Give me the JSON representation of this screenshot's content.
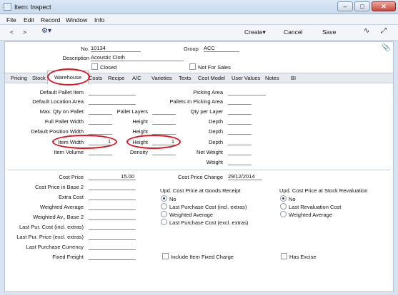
{
  "window": {
    "title": "Item: Inspect",
    "minimize": "–",
    "maximize": "□",
    "close": "✕"
  },
  "menu": [
    "File",
    "Edit",
    "Record",
    "Window",
    "Info"
  ],
  "toolbar": {
    "prev": "<",
    "next": ">",
    "gear": "⚙▾",
    "create": "Create▾",
    "cancel": "Cancel",
    "save": "Save",
    "chart": "∿",
    "expand": "⤢"
  },
  "header": {
    "no_label": "No.",
    "no_value": "10134",
    "group_label": "Group",
    "group_value": "ACC",
    "description_label": "Description",
    "description_value": "Acoustic Cloth",
    "closed_label": "Closed",
    "not_for_sales_label": "Not For Sales",
    "paperclip": "📎"
  },
  "tabs": [
    "Pricing",
    "Stock",
    "Warehouse",
    "Costs",
    "Recipe",
    "A/C",
    "Varieties",
    "Texts",
    "Cost Model",
    "User Values",
    "Notes",
    "BI"
  ],
  "active_tab": "Warehouse",
  "warehouse": {
    "default_pallet_item": "Default Pallet Item",
    "default_location_area": "Default Location Area",
    "max_qty_on_pallet": "Max. Qty on Pallet",
    "pallet_layers": "Pallet Layers",
    "full_pallet_width": "Full Pallet Width",
    "height": "Height",
    "default_position_width": "Default Position Width",
    "item_width": "Item Width",
    "item_width_value": "1",
    "item_height_value": "1",
    "item_volume": "Item Volume",
    "density": "Density",
    "picking_area": "Picking Area",
    "pallets_in_picking_area": "Pallets In Picking Area",
    "qty_per_layer": "Qty per Layer",
    "depth": "Depth",
    "net_weight": "Net Weight",
    "weight": "Weight"
  },
  "costs": {
    "cost_price": "Cost Price",
    "cost_price_value": "15.00",
    "cost_price_in_base2": "Cost Price in Base 2",
    "extra_cost": "Extra Cost",
    "weighted_average": "Weighted Average",
    "weighted_av_base2": "Weighted Av., Base 2",
    "last_pur_cost_incl": "Last Pur. Cost (incl. extras)",
    "last_pur_price_excl": "Last Pur. Price (excl. extras)",
    "last_purchase_currency": "Last Purchase Currency",
    "fixed_freight": "Fixed Freight",
    "cost_price_change": "Cost Price Change",
    "cost_price_change_value": "29/12/2014",
    "upd_goods_receipt": "Upd. Cost Price at Goods Receipt",
    "gr_options": [
      "No",
      "Last Purchase Cost (incl. extras)",
      "Weighted Average",
      "Last Purchase Cost (excl. extras)"
    ],
    "upd_stock_reval": "Upd. Cost Price at Stock Revaluation",
    "sr_options": [
      "No",
      "Last Revaluation Cost",
      "Weighted Average"
    ],
    "include_item_fixed_charge": "Include Item Fixed Charge",
    "has_excise": "Has Excise"
  }
}
